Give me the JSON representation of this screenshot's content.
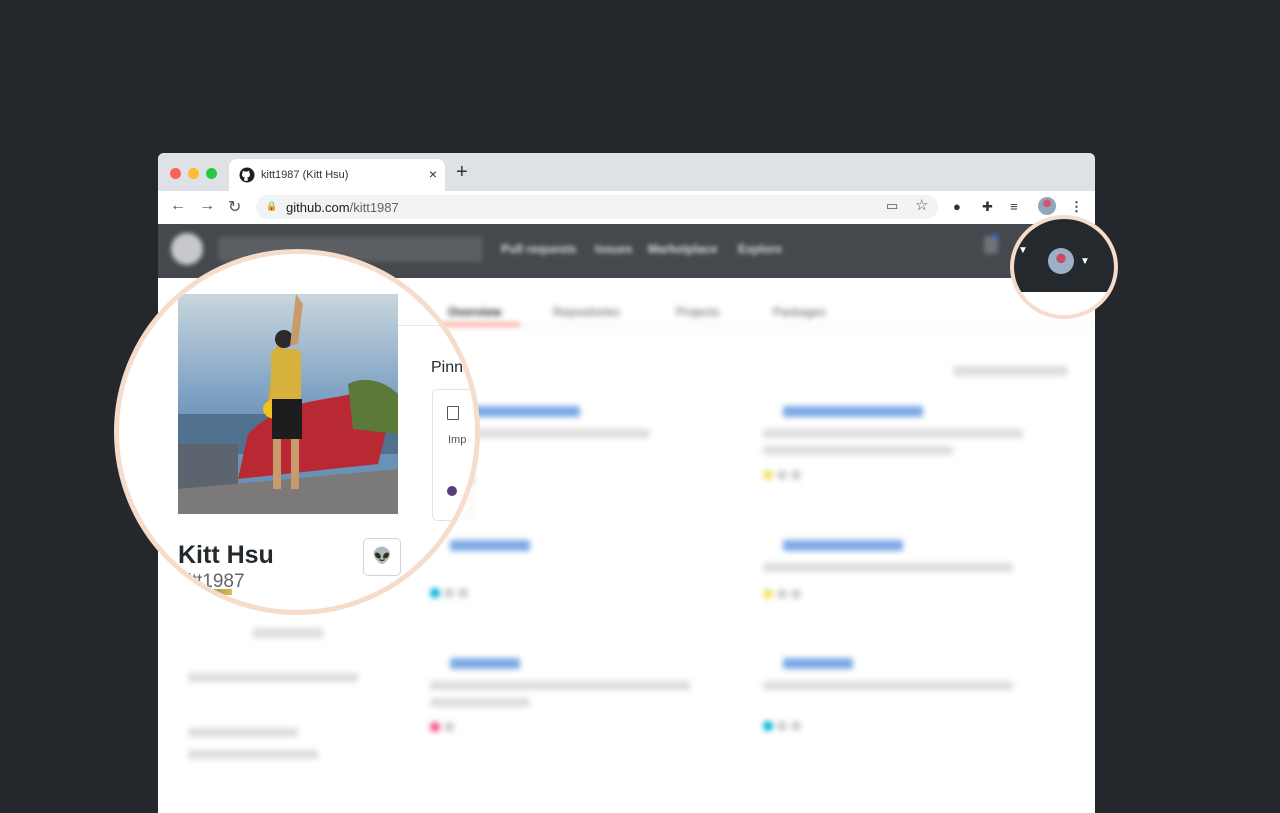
{
  "browser": {
    "tab_title": "kitt1987 (Kitt Hsu)",
    "tab_close": "×",
    "new_tab": "+",
    "url_domain": "github.com",
    "url_path": "/kitt1987"
  },
  "colors": {
    "accent": "#2f7ad7",
    "highlight_ring": "#f5dccb"
  },
  "profile": {
    "name": "Kitt Hsu",
    "username": "kitt1987",
    "status_icon": "👽"
  },
  "gh_nav": [
    "Pull requests",
    "Issues",
    "Marketplace",
    "Explore"
  ],
  "profile_tabs": [
    "Overview",
    "Repositories",
    "Projects",
    "Packages"
  ],
  "pinned": {
    "heading": "Pinned",
    "first_card_desc_start": "Imp"
  }
}
